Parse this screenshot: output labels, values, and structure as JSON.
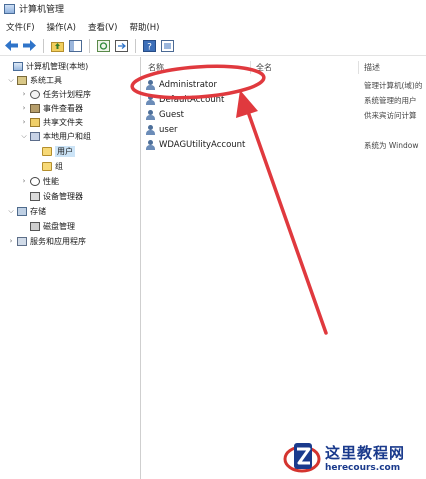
{
  "window": {
    "title": "计算机管理"
  },
  "menu": [
    {
      "label": "文件(F)"
    },
    {
      "label": "操作(A)"
    },
    {
      "label": "查看(V)"
    },
    {
      "label": "帮助(H)"
    }
  ],
  "toolbar": {
    "icons": [
      "back-arrow-icon",
      "forward-arrow-icon",
      "up-folder-icon",
      "show-tree-icon",
      "refresh-icon",
      "export-list-icon",
      "help-icon",
      "properties-icon"
    ]
  },
  "tree": {
    "items": [
      {
        "label": "计算机管理(本地)",
        "chevron": "",
        "icon": "computer-icon",
        "level": 0
      },
      {
        "label": "系统工具",
        "chevron": "⌵",
        "icon": "tools-icon",
        "level": 1
      },
      {
        "label": "任务计划程序",
        "chevron": "›",
        "icon": "clock-icon",
        "level": 2
      },
      {
        "label": "事件查看器",
        "chevron": "›",
        "icon": "event-log-icon",
        "level": 2
      },
      {
        "label": "共享文件夹",
        "chevron": "›",
        "icon": "shared-folder-icon",
        "level": 2
      },
      {
        "label": "本地用户和组",
        "chevron": "⌵",
        "icon": "users-icon",
        "level": 2
      },
      {
        "label": "用户",
        "chevron": "",
        "icon": "folder-icon",
        "level": 3,
        "selected": true
      },
      {
        "label": "组",
        "chevron": "",
        "icon": "folder-icon",
        "level": 3
      },
      {
        "label": "性能",
        "chevron": "›",
        "icon": "performance-icon",
        "level": 2
      },
      {
        "label": "设备管理器",
        "chevron": "",
        "icon": "device-manager-icon",
        "level": 2
      },
      {
        "label": "存储",
        "chevron": "⌵",
        "icon": "storage-icon",
        "level": 1
      },
      {
        "label": "磁盘管理",
        "chevron": "",
        "icon": "disk-icon",
        "level": 2
      },
      {
        "label": "服务和应用程序",
        "chevron": "›",
        "icon": "services-icon",
        "level": 1
      }
    ]
  },
  "list": {
    "columns": {
      "name": "名称",
      "fullname": "全名",
      "description": "描述"
    },
    "rows": [
      {
        "name": "Administrator",
        "fullname": "",
        "description": "管理计算机(域)的"
      },
      {
        "name": "DefaultAccount",
        "fullname": "",
        "description": "系统管理的用户"
      },
      {
        "name": "Guest",
        "fullname": "",
        "description": "供来宾访问计算"
      },
      {
        "name": "user",
        "fullname": "",
        "description": ""
      },
      {
        "name": "WDAGUtilityAccount",
        "fullname": "",
        "description": "系统为 Window"
      }
    ]
  },
  "annotation": {
    "color": "#e0393e"
  },
  "watermark": {
    "chinese": "这里教程网",
    "url": "herecours.com"
  }
}
